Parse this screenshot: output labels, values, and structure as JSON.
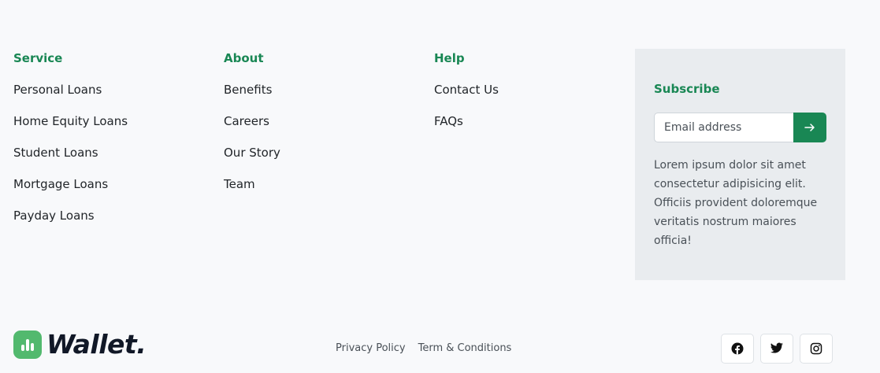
{
  "service": {
    "title": "Service",
    "links": [
      "Personal Loans",
      "Home Equity Loans",
      "Student Loans",
      "Mortgage Loans",
      "Payday Loans"
    ]
  },
  "about": {
    "title": "About",
    "links": [
      "Benefits",
      "Careers",
      "Our Story",
      "Team"
    ]
  },
  "help": {
    "title": "Help",
    "links": [
      "Contact Us",
      "FAQs"
    ]
  },
  "subscribe": {
    "title": "Subscribe",
    "placeholder": "Email address",
    "submit_icon": "arrow-right-icon",
    "text": "Lorem ipsum dolor sit amet consectetur adipisicing elit. Officiis provident doloremque veritatis nostrum maiores officia!"
  },
  "brand": {
    "name": "Wallet.",
    "logo_icon": "bar-chart-icon",
    "logo_color": "#52b96e"
  },
  "legal": {
    "links": [
      "Privacy Policy",
      "Term & Conditions"
    ]
  },
  "social": {
    "icons": [
      "facebook-icon",
      "twitter-icon",
      "instagram-icon"
    ]
  },
  "colors": {
    "accent": "#198754",
    "background": "#f8f9fb",
    "panel": "#e9ecef"
  }
}
